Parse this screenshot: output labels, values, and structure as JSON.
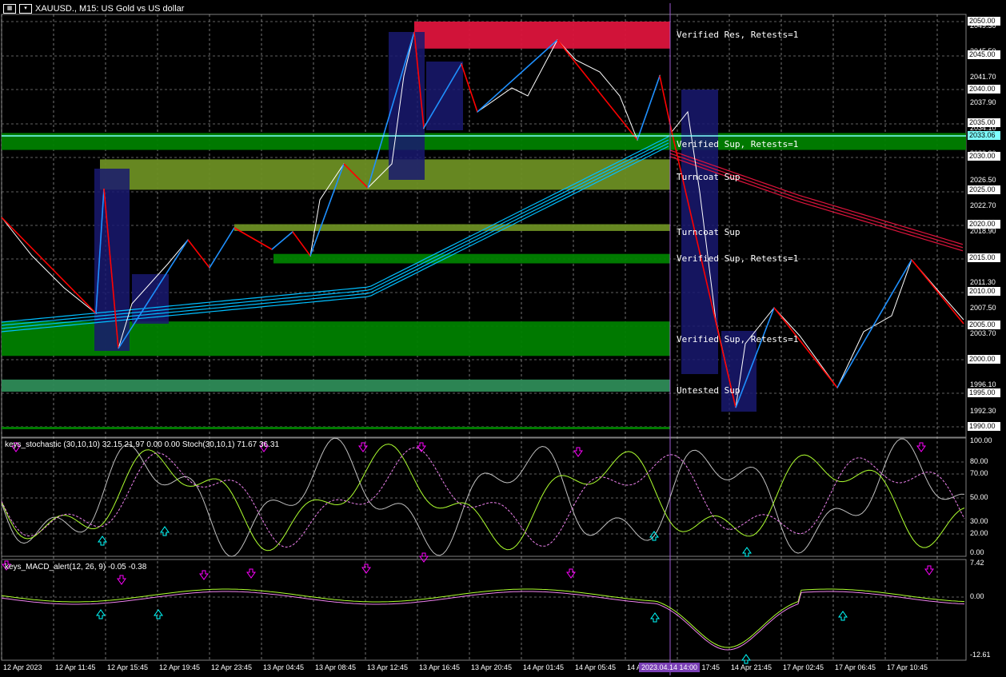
{
  "header": {
    "title": "XAUUSD., M15:  US Gold vs US dollar"
  },
  "stoch_title": "keys_stochastic (30,10,10) 32.15 21.97 0.00 0.00 Stoch(30,10,1) 71.67 36.31",
  "macd_title": "keys_MACD_alert(12, 26, 9) -0.05 -0.38",
  "zone_labels": [
    "Verified Res, Retests=1",
    "Verified Sup, Retests=1",
    "Turncoat Sup",
    "Turncoat Sup",
    "Verified Sup, Retests=1",
    "Verified Sup, Retests=1",
    "Untested Sup"
  ],
  "price_axis": [
    "2049.30",
    "2045.50",
    "2041.70",
    "2037.90",
    "2034.10",
    "2030.30",
    "2026.50",
    "2022.70",
    "2018.90",
    "2015.10",
    "2011.30",
    "2007.50",
    "2003.70",
    "1999.90",
    "1996.10",
    "1992.30"
  ],
  "price_boxes": [
    "2050.00",
    "2045.00",
    "2040.00",
    "2035.00",
    "2033.06",
    "2030.00",
    "2025.00",
    "2020.00",
    "2015.00",
    "2010.00",
    "2005.00",
    "2000.00",
    "1995.00",
    "1990.00"
  ],
  "stoch_axis": [
    "100.00",
    "80.00",
    "70.00",
    "50.00",
    "30.00",
    "20.00",
    "0.00"
  ],
  "macd_axis": [
    "7.42",
    "0.00",
    "-12.61"
  ],
  "time_axis": [
    "12 Apr 2023",
    "12 Apr 11:45",
    "12 Apr 15:45",
    "12 Apr 19:45",
    "12 Apr 23:45",
    "13 Apr 04:45",
    "13 Apr 08:45",
    "13 Apr 12:45",
    "13 Apr 16:45",
    "13 Apr 20:45",
    "14 Apr 01:45",
    "14 Apr 05:45",
    "14 Apr",
    "14 Apr 17:45",
    "14 Apr 21:45",
    "17 Apr 02:45",
    "17 Apr 06:45",
    "17 Apr 10:45"
  ],
  "crosshair_time": "2023.04.14 14:00",
  "colors": {
    "res": "#dc143c",
    "sup": "#008000",
    "turncoat": "#6b8e23",
    "untested": "#2e8b57",
    "box": "#191970",
    "zigup": "#1e90ff",
    "zigdn": "#ff0000",
    "ma": "#00bfff",
    "ma2": "#dc143c",
    "grid": "#c0c0c0"
  }
}
